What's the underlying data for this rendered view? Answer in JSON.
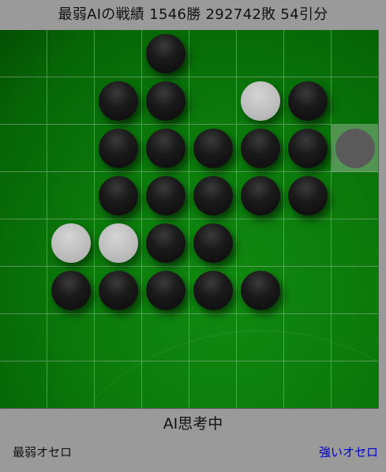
{
  "header": {
    "score_text": "最弱AIの戦績 1546勝 292742敗 54引分"
  },
  "board": {
    "size": 8,
    "rows": [
      "...B....",
      "..BB.WB.",
      "..BBBBBG",
      "..BBBBB.",
      ".WWBB...",
      ".BBBBB..",
      "........",
      "........"
    ],
    "legend": {
      "B": "black",
      "W": "white",
      "G": "last-move-ghost",
      ".": "empty"
    }
  },
  "status": {
    "text": "AI思考中"
  },
  "footer": {
    "left_label": "最弱オセロ",
    "right_link": "強いオセロ"
  },
  "colors": {
    "background": "#9a9a9a",
    "board_green": "#0b7a0b",
    "link": "#0000cc"
  }
}
